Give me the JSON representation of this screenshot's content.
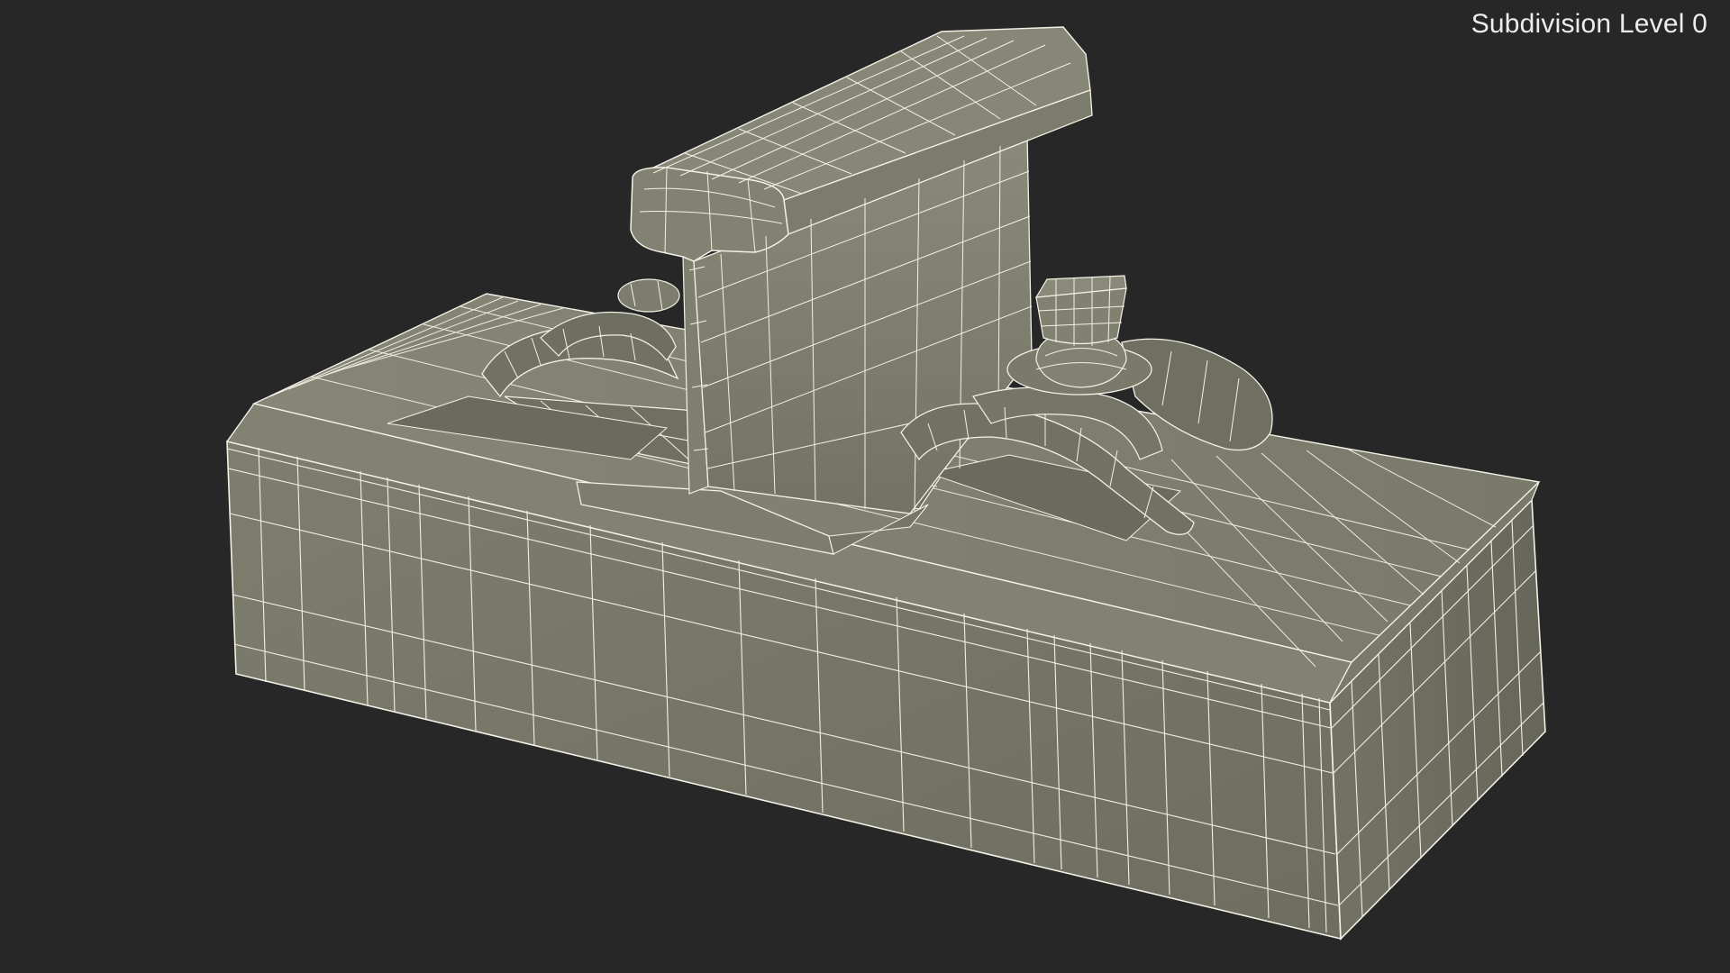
{
  "viewport": {
    "subdivision_label": "Subdivision Level 0",
    "background_color": "#272727",
    "mesh_fill_color": "#7b7b6c",
    "wire_color": "#f3f1e6"
  },
  "model": {
    "parts": [
      "sleeper-block",
      "rail",
      "rail-clip-left",
      "rail-clip-right",
      "anchor-bolt"
    ]
  }
}
